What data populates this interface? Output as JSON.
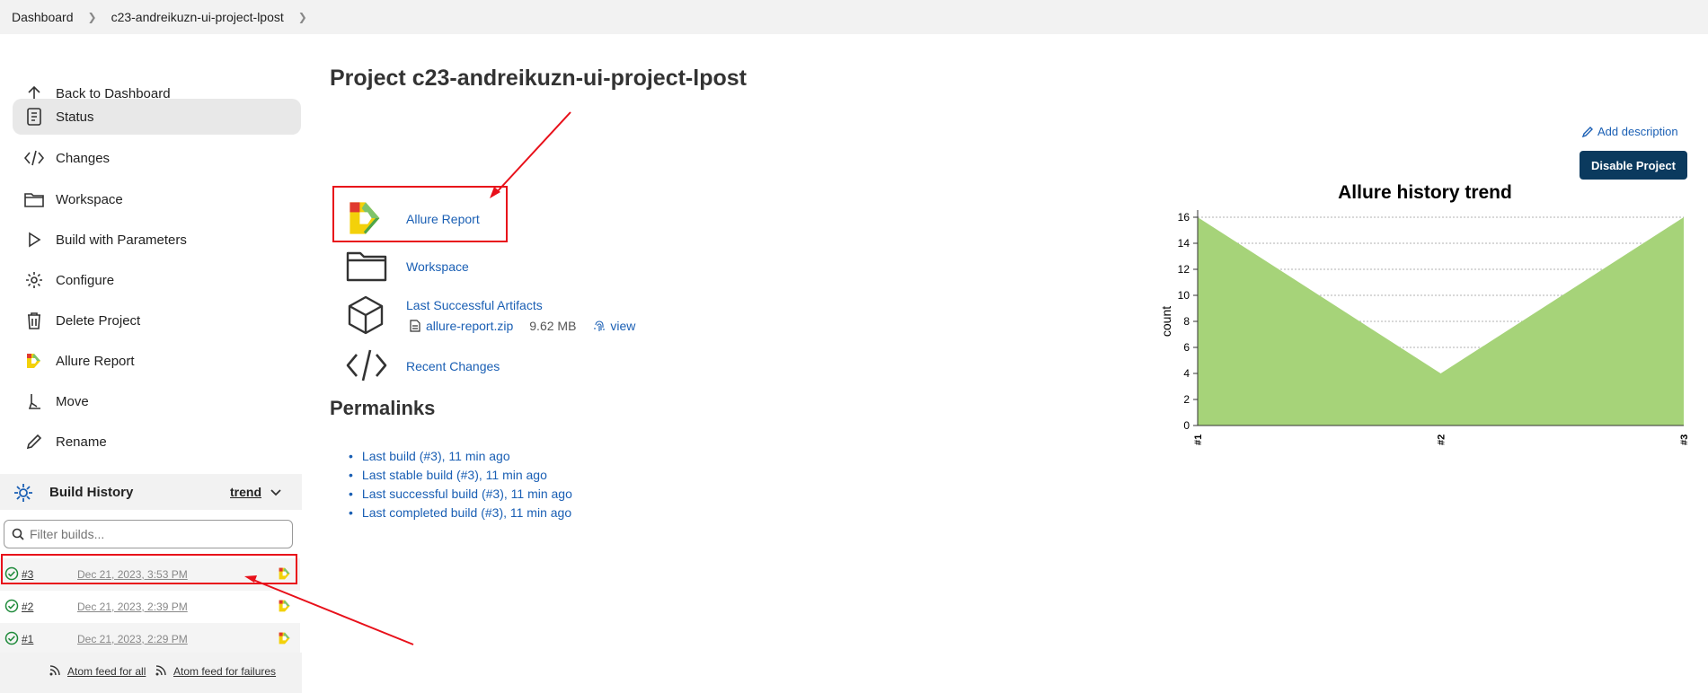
{
  "breadcrumb": {
    "dashboard": "Dashboard",
    "project": "c23-andreikuzn-ui-project-lpost"
  },
  "sidebar": {
    "items": [
      {
        "label": "Back to Dashboard",
        "icon": "arrow-up-icon"
      },
      {
        "label": "Status",
        "icon": "document-icon",
        "active": true
      },
      {
        "label": "Changes",
        "icon": "code-icon"
      },
      {
        "label": "Workspace",
        "icon": "folder-icon"
      },
      {
        "label": "Build with Parameters",
        "icon": "play-icon"
      },
      {
        "label": "Configure",
        "icon": "gear-icon"
      },
      {
        "label": "Delete Project",
        "icon": "trash-icon"
      },
      {
        "label": "Allure Report",
        "icon": "allure-logo-icon"
      },
      {
        "label": "Move",
        "icon": "move-icon"
      },
      {
        "label": "Rename",
        "icon": "pencil-icon"
      }
    ]
  },
  "build_history": {
    "title": "Build History",
    "trend_label": "trend",
    "filter_placeholder": "Filter builds...",
    "builds": [
      {
        "number": "#3",
        "date": "Dec 21, 2023, 3:53 PM",
        "status": "success"
      },
      {
        "number": "#2",
        "date": "Dec 21, 2023, 2:39 PM",
        "status": "success"
      },
      {
        "number": "#1",
        "date": "Dec 21, 2023, 2:29 PM",
        "status": "success"
      }
    ],
    "feed_all": "Atom feed for all",
    "feed_failures": "Atom feed for failures"
  },
  "main": {
    "title": "Project c23-andreikuzn-ui-project-lpost",
    "add_description": "Add description",
    "disable_button": "Disable Project",
    "actions": {
      "allure": "Allure Report",
      "workspace": "Workspace",
      "artifacts": "Last Successful Artifacts",
      "changes": "Recent Changes"
    },
    "artifact": {
      "file": "allure-report.zip",
      "size": "9.62 MB",
      "view": "view"
    },
    "permalinks_title": "Permalinks",
    "permalinks": [
      "Last build (#3), 11 min ago",
      "Last stable build (#3), 11 min ago",
      "Last successful build (#3), 11 min ago",
      "Last completed build (#3), 11 min ago"
    ]
  },
  "colors": {
    "accent": "#1a5fb4",
    "button": "#0b3a5e",
    "chart_fill": "#a6d379",
    "annotation": "#e8101a"
  },
  "chart_data": {
    "type": "area",
    "title": "Allure history trend",
    "ylabel": "count",
    "xlabel": "",
    "categories": [
      "#1",
      "#2",
      "#3"
    ],
    "values": [
      16,
      4,
      16
    ],
    "ylim": [
      0,
      16
    ],
    "yticks": [
      "0",
      "2",
      "4",
      "6",
      "8",
      "10",
      "12",
      "14",
      "16"
    ],
    "grid": true
  }
}
